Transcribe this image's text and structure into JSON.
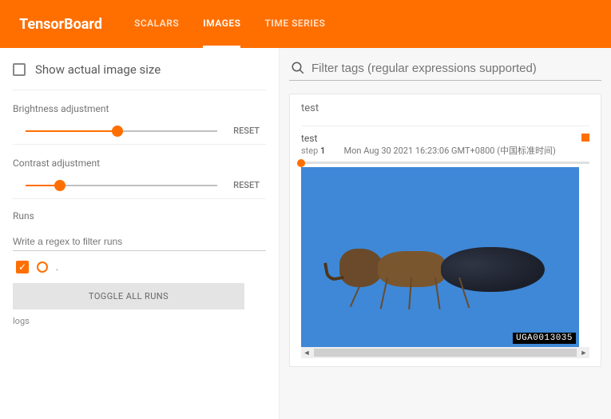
{
  "header": {
    "logo": "TensorBoard",
    "tabs": [
      {
        "label": "SCALARS",
        "active": false
      },
      {
        "label": "IMAGES",
        "active": true
      },
      {
        "label": "TIME SERIES",
        "active": false
      }
    ]
  },
  "sidebar": {
    "actual_size_label": "Show actual image size",
    "actual_size_checked": false,
    "brightness": {
      "title": "Brightness adjustment",
      "reset": "RESET",
      "percent": 48
    },
    "contrast": {
      "title": "Contrast adjustment",
      "reset": "RESET",
      "percent": 18
    },
    "runs": {
      "title": "Runs",
      "filter_placeholder": "Write a regex to filter runs",
      "checked": true,
      "run_label": ".",
      "toggle_label": "TOGGLE ALL RUNS",
      "logs": "logs"
    }
  },
  "main": {
    "filter_placeholder": "Filter tags (regular expressions supported)",
    "card_title": "test",
    "image": {
      "label": "test",
      "step_prefix": "step ",
      "step": "1",
      "timestamp": "Mon Aug 30 2021 16:23:06 GMT+0800 (中国标准时间)",
      "watermark": "UGA0013035"
    }
  },
  "icons": {
    "search": "search-icon",
    "close": "close-icon"
  }
}
